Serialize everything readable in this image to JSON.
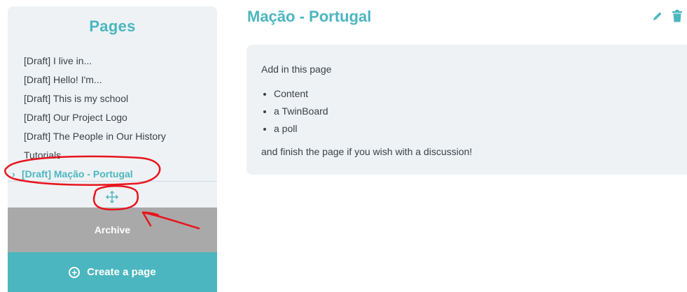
{
  "sidebar": {
    "title": "Pages",
    "items": [
      {
        "label": "[Draft] I live in..."
      },
      {
        "label": "[Draft] Hello! I'm..."
      },
      {
        "label": "[Draft] This is my school"
      },
      {
        "label": "[Draft] Our Project Logo"
      },
      {
        "label": "[Draft] The People in Our History"
      },
      {
        "label": "Tutorials"
      },
      {
        "label": "[Draft] Mação - Portugal",
        "active": true
      }
    ],
    "active_chevron": "›",
    "move_handle_icon": "move-arrows-icon",
    "archive_label": "Archive",
    "create_label": "Create a page",
    "create_icon": "plus-circle-icon"
  },
  "main": {
    "title": "Mação - Portugal",
    "edit_icon": "pencil-icon",
    "delete_icon": "trash-icon",
    "content": {
      "intro": "Add in this page",
      "bullets": [
        "Content",
        "a TwinBoard",
        "a poll"
      ],
      "outro": "and finish the page if you wish with a discussion!"
    }
  },
  "colors": {
    "accent": "#4bb6bf",
    "archive_bg": "#a9a9a9",
    "panel_bg": "#eef2f5",
    "annotation": "#e8141c"
  }
}
